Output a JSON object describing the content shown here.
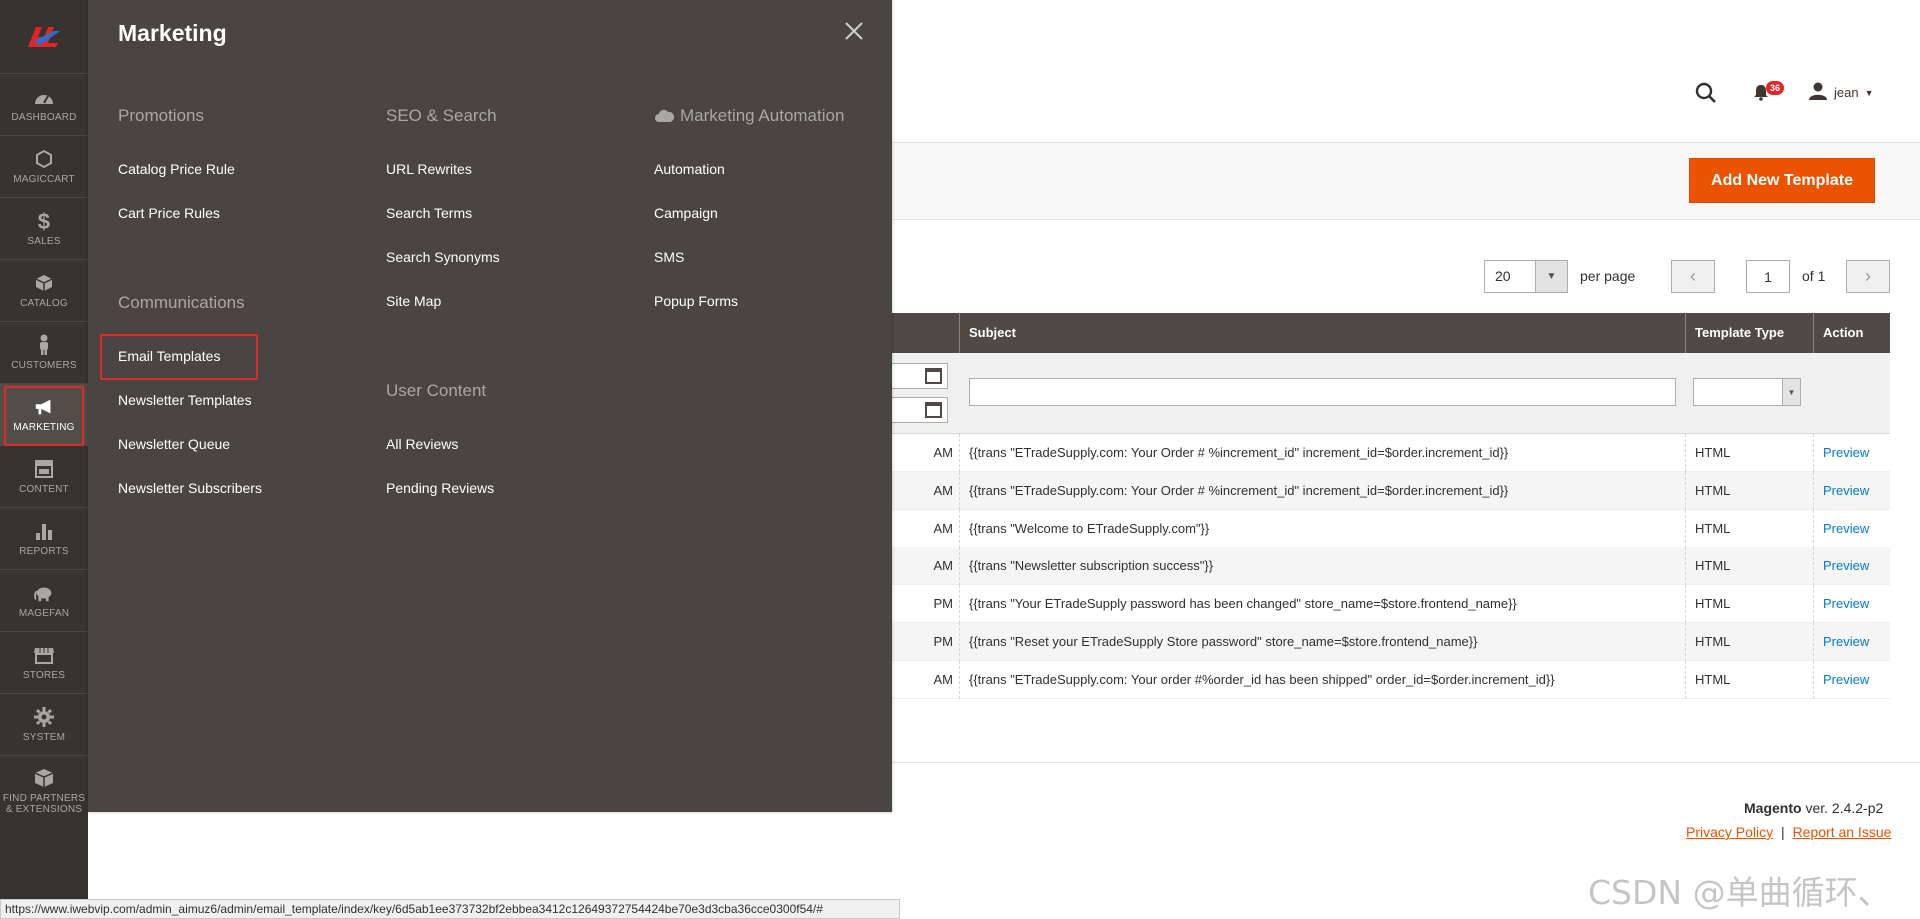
{
  "nav": {
    "items": [
      {
        "label": "DASHBOARD",
        "icon": "dashboard-icon"
      },
      {
        "label": "MAGICCART",
        "icon": "hexagon-icon"
      },
      {
        "label": "SALES",
        "icon": "dollar-icon"
      },
      {
        "label": "CATALOG",
        "icon": "box-icon"
      },
      {
        "label": "CUSTOMERS",
        "icon": "person-icon"
      },
      {
        "label": "MARKETING",
        "icon": "megaphone-icon"
      },
      {
        "label": "CONTENT",
        "icon": "layout-icon"
      },
      {
        "label": "REPORTS",
        "icon": "bar-chart-icon"
      },
      {
        "label": "MAGEFAN",
        "icon": "elephant-icon"
      },
      {
        "label": "STORES",
        "icon": "store-icon"
      },
      {
        "label": "SYSTEM",
        "icon": "gear-icon"
      },
      {
        "label": "FIND PARTNERS & EXTENSIONS",
        "icon": "cube-icon"
      }
    ]
  },
  "header": {
    "notifications_count": "36",
    "user": "jean"
  },
  "actions": {
    "add_template": "Add New Template"
  },
  "pager": {
    "per_page_value": "20",
    "per_page_label": "per page",
    "page": "1",
    "of_label": "of 1"
  },
  "grid": {
    "headers": {
      "subject": "Subject",
      "template_type": "Template Type",
      "action": "Action"
    },
    "rows": [
      {
        "date_tail": "AM",
        "subject": "{{trans \"ETradeSupply.com: Your Order # %increment_id\" increment_id=$order.increment_id}}",
        "type": "HTML",
        "action": "Preview"
      },
      {
        "date_tail": "AM",
        "subject": "{{trans \"ETradeSupply.com: Your Order # %increment_id\" increment_id=$order.increment_id}}",
        "type": "HTML",
        "action": "Preview"
      },
      {
        "date_tail": "AM",
        "subject": "{{trans \"Welcome to ETradeSupply.com\"}}",
        "type": "HTML",
        "action": "Preview"
      },
      {
        "date_tail": "AM",
        "subject": "{{trans \"Newsletter subscription success\"}}",
        "type": "HTML",
        "action": "Preview"
      },
      {
        "date_tail": "PM",
        "subject": "{{trans \"Your ETradeSupply password has been changed\" store_name=$store.frontend_name}}",
        "type": "HTML",
        "action": "Preview"
      },
      {
        "date_tail": "PM",
        "subject": "{{trans \"Reset your ETradeSupply Store password\" store_name=$store.frontend_name}}",
        "type": "HTML",
        "action": "Preview"
      },
      {
        "date_tail": "AM",
        "subject": "{{trans \"ETradeSupply.com: Your order #%order_id has been shipped\" order_id=$order.increment_id}}",
        "type": "HTML",
        "action": "Preview"
      }
    ]
  },
  "footer": {
    "brand": "Magento",
    "version": "ver. 2.4.2-p2",
    "privacy": "Privacy Policy",
    "separator": "|",
    "report": "Report an Issue"
  },
  "flyout": {
    "title": "Marketing",
    "columns": {
      "promotions": {
        "title": "Promotions",
        "links": [
          "Catalog Price Rule",
          "Cart Price Rules"
        ]
      },
      "communications": {
        "title": "Communications",
        "links": [
          "Email Templates",
          "Newsletter Templates",
          "Newsletter Queue",
          "Newsletter Subscribers"
        ]
      },
      "seo": {
        "title": "SEO & Search",
        "links": [
          "URL Rewrites",
          "Search Terms",
          "Search Synonyms",
          "Site Map"
        ]
      },
      "user_content": {
        "title": "User Content",
        "links": [
          "All Reviews",
          "Pending Reviews"
        ]
      },
      "automation": {
        "title": "Marketing Automation",
        "links": [
          "Automation",
          "Campaign",
          "SMS",
          "Popup Forms"
        ]
      }
    }
  },
  "statusbar": "https://www.iwebvip.com/admin_aimuz6/admin/email_template/index/key/6d5ab1ee373732bf2ebbea3412c12649372754424be70e3d3cba36cce0300f54/#",
  "watermark": "CSDN @单曲循环、",
  "colors": {
    "accent": "#eb5202",
    "nav_bg": "#373330",
    "flyout_bg": "#4a4542",
    "highlight": "#e02b27",
    "link": "#007bdb"
  }
}
